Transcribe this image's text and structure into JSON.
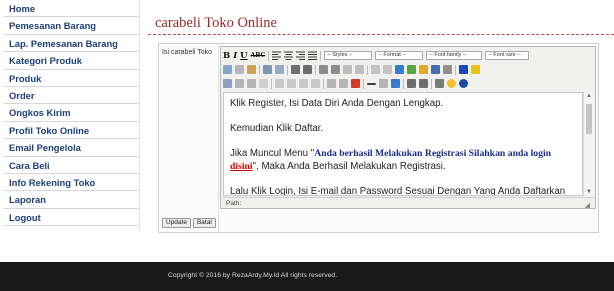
{
  "sidebar": {
    "items": [
      {
        "label": "Home"
      },
      {
        "label": "Pemesanan Barang"
      },
      {
        "label": "Lap. Pemesanan Barang"
      },
      {
        "label": "Kategori Produk"
      },
      {
        "label": "Produk"
      },
      {
        "label": "Order"
      },
      {
        "label": "Ongkos Kirim"
      },
      {
        "label": "Profil Toko Online"
      },
      {
        "label": "Email Pengelola"
      },
      {
        "label": "Cara Beli"
      },
      {
        "label": "Info Rekening Toko"
      },
      {
        "label": "Laporan"
      },
      {
        "label": "Logout"
      }
    ]
  },
  "main": {
    "title": "carabeli Toko Online",
    "field_label": "Isi carabeli Toko"
  },
  "editor": {
    "toolbar": {
      "bold": "B",
      "italic": "I",
      "underline": "U",
      "strike": "ABC",
      "styles": "-- Styles --",
      "format": "-- Format --",
      "font_family": "-- Font family --",
      "font_size": "-- Font size --"
    },
    "content": {
      "p1": "Klik Register, Isi Data Diri Anda Dengan Lengkap.",
      "p2": "Kemudian Klik Daftar.",
      "p3_before": "Jika Muncul Menu \"",
      "p3_bold1": "Anda berhasil Melakukan Registrasi Silahkan anda login",
      "p3_link": "disini",
      "p3_after": "\", Maka Anda Berhasil Melakukan Registrasi.",
      "p4": "Lalu Klik Login, Isi E-mail dan Password Sesuai Dengan Yang Anda Daftarkan Di Menu Register!!!"
    },
    "path_label": "Path:"
  },
  "buttons": {
    "update": "Update",
    "cancel": "Batal"
  },
  "footer": {
    "text": "Copyright © 2016 by RezaArdy.My.Id All rights reserved."
  },
  "colors": {
    "sidebar_link": "#1d3f7a",
    "title": "#9c2a2a",
    "footer_bg": "#191919"
  }
}
